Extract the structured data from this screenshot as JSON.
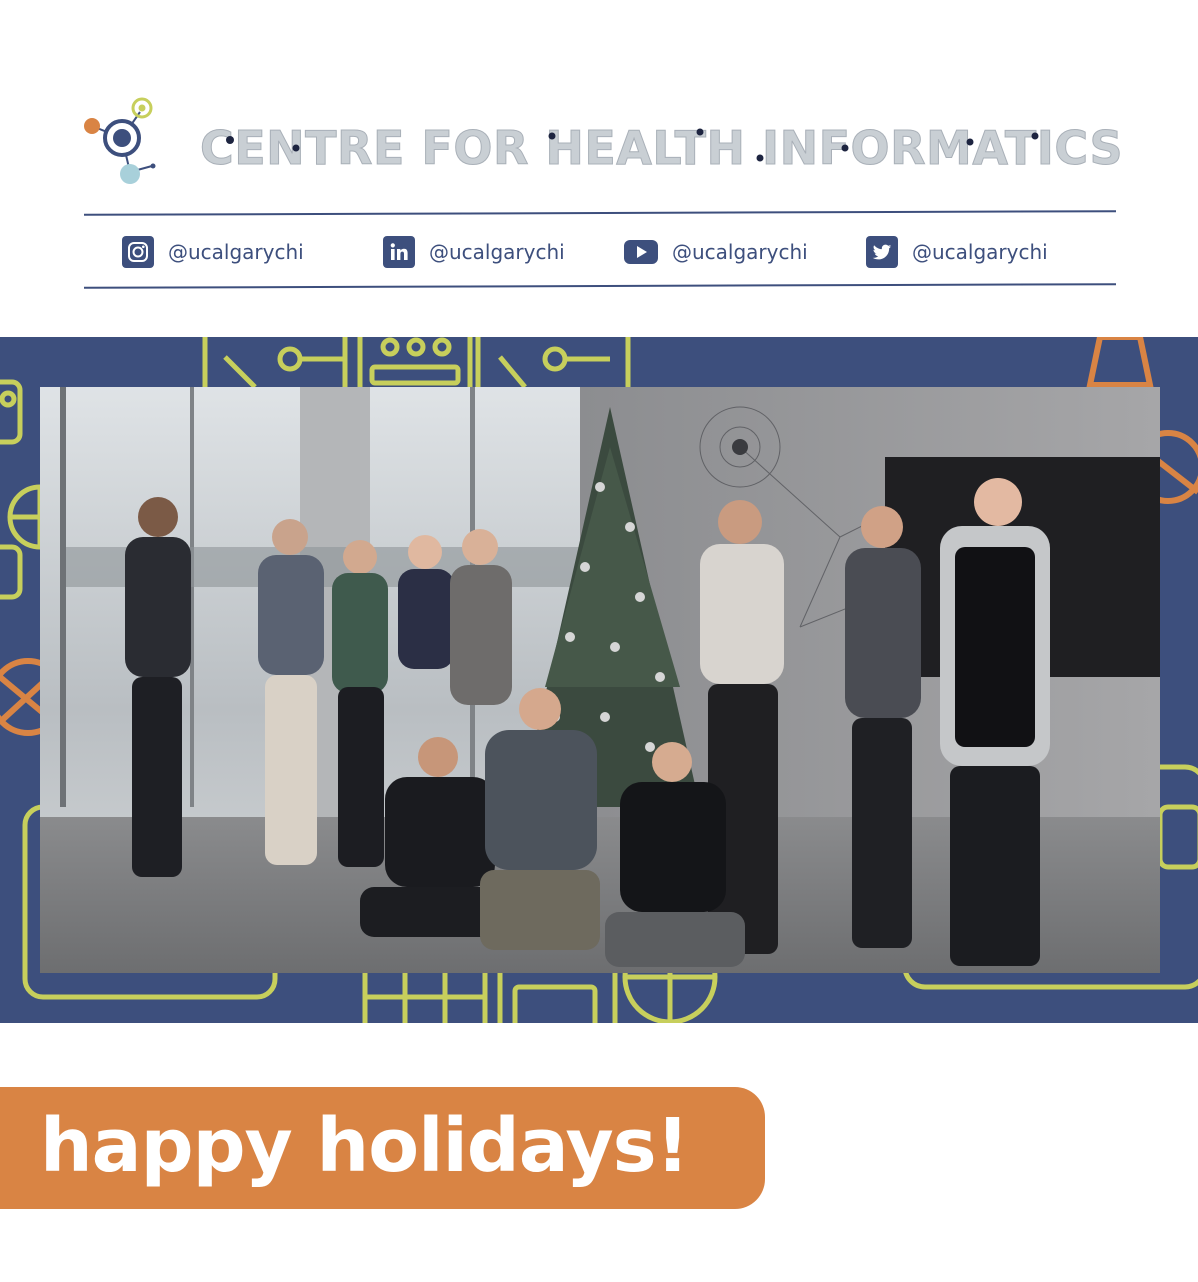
{
  "header": {
    "org_name": "CENTRE FOR HEALTH INFORMATICS",
    "logo_icon": "molecule-logo-icon"
  },
  "socials": [
    {
      "icon": "instagram-icon",
      "handle": "@ucalgarychi"
    },
    {
      "icon": "linkedin-icon",
      "handle": "@ucalgarychi"
    },
    {
      "icon": "youtube-icon",
      "handle": "@ucalgarychi"
    },
    {
      "icon": "twitter-icon",
      "handle": "@ucalgarychi"
    }
  ],
  "colors": {
    "navy": "#3d4f7d",
    "orange": "#d98444",
    "lime": "#c7cf5c",
    "title_grey": "#c9cfd4"
  },
  "greeting": {
    "text": "happy holidays!"
  }
}
